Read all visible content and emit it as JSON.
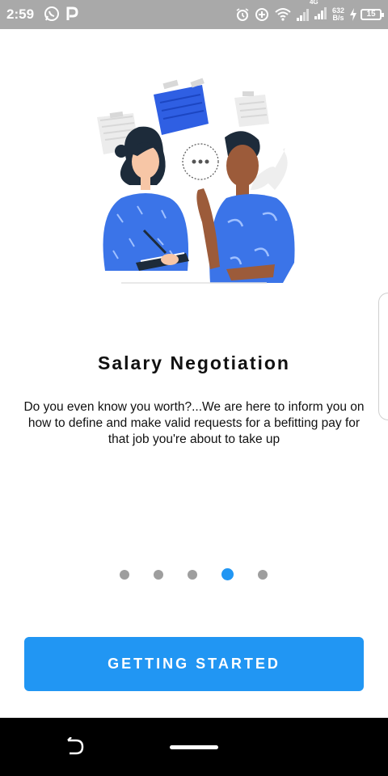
{
  "status_bar": {
    "time": "2:59",
    "network_type": "4G",
    "net_speed_value": "632",
    "net_speed_unit": "B/s",
    "battery": "15",
    "icons": [
      "whatsapp-icon",
      "p-app-icon",
      "alarm-icon",
      "data-saver-icon",
      "wifi-icon",
      "signal-icon",
      "signal-icon-2",
      "charging-icon",
      "battery-icon"
    ]
  },
  "onboarding": {
    "illustration": "two-people-talking-illustration",
    "title": "Salary Negotiation",
    "description": "Do you even know you worth?...We are here to inform you on how to define and make valid requests for a befitting pay for that job you're about to take up",
    "page_count": 5,
    "active_page_index": 3,
    "cta_label": "GETTING STARTED"
  },
  "colors": {
    "accent": "#2196f3",
    "dot_inactive": "#9e9e9e",
    "status_bar_bg": "#a9a9a9",
    "nav_bar_bg": "#000000"
  },
  "nav_bar": {
    "icons": [
      "back-gesture-icon",
      "home-pill-icon"
    ]
  }
}
